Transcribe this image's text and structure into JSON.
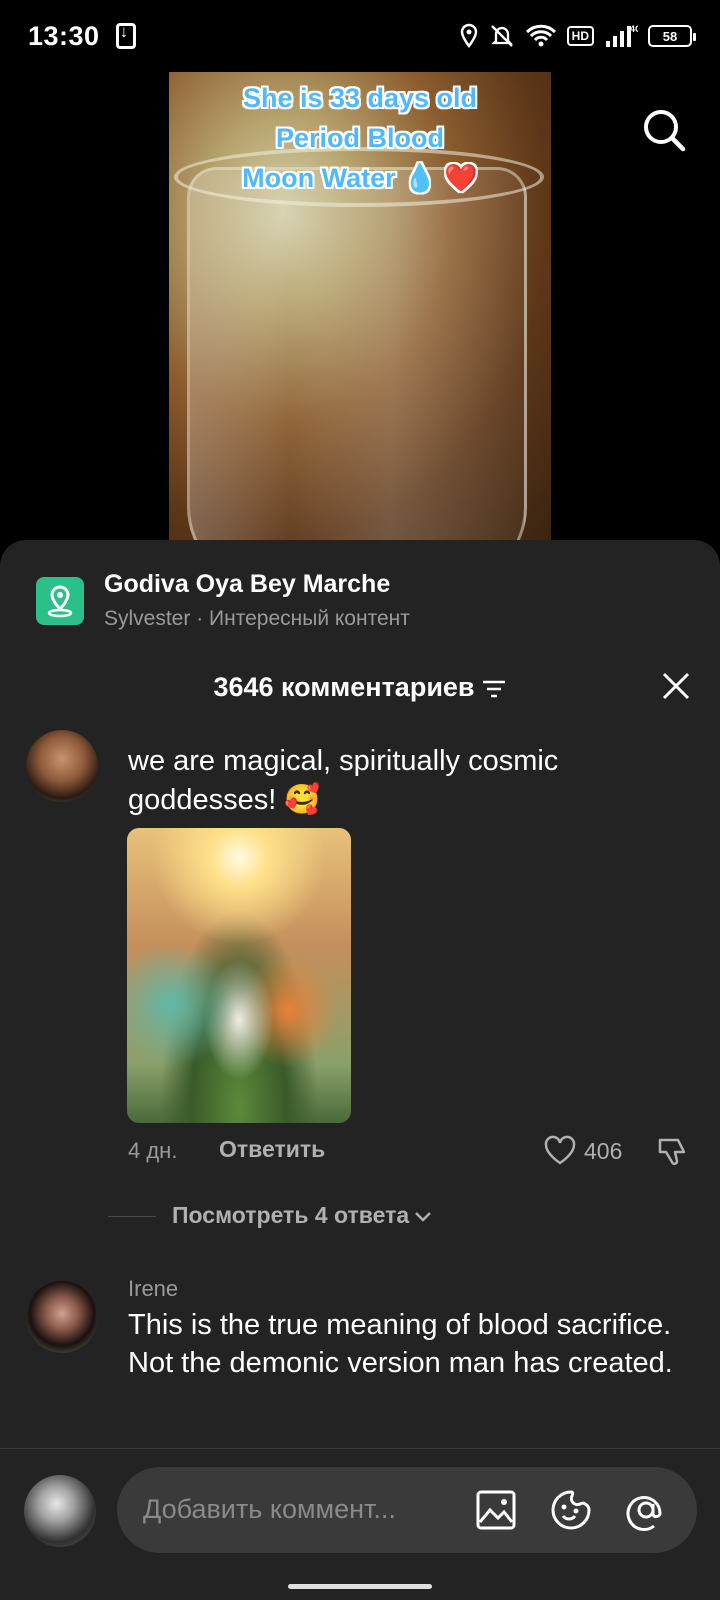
{
  "status_bar": {
    "time": "13:30",
    "network": "4G",
    "hd": "HD",
    "battery": "58"
  },
  "video": {
    "overlay_lines": [
      "She is 33 days old",
      "Period Blood",
      "Moon Water 💧 ❤️"
    ]
  },
  "promo": {
    "title": "Godiva Oya Bey Marche",
    "subtitle": "Sylvester · Интересный контент",
    "icon": "map-pin-icon",
    "icon_color": "#2bbf8a"
  },
  "comments_header": {
    "title": "3646 комментариев"
  },
  "comments": [
    {
      "text": "we are magical, spiritually cosmic goddesses! 🥰",
      "time": "4 дн.",
      "reply_label": "Ответить",
      "likes": "406",
      "view_replies": "Посмотреть 4 ответа"
    },
    {
      "author": "Irene",
      "text": "This is the true meaning of blood sacrifice. Not the demonic version man has created."
    }
  ],
  "input": {
    "placeholder": "Добавить коммент..."
  },
  "colors": {
    "sheet_bg": "#232323",
    "overlay_text": "#4fb8ff",
    "secondary_text": "#9a9a9a"
  }
}
